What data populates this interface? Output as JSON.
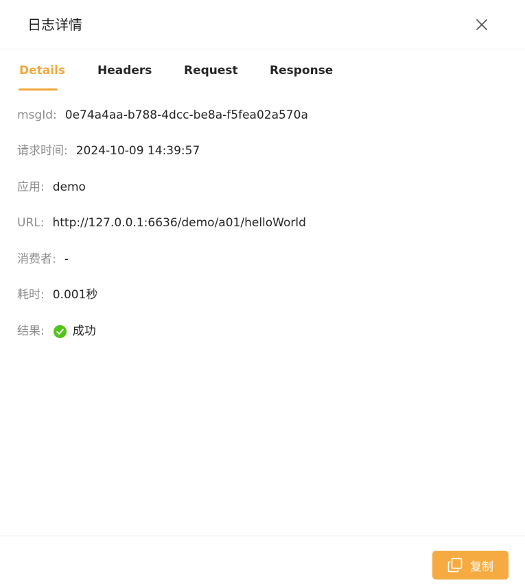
{
  "dialog": {
    "title": "日志详情",
    "close_icon": "close-icon"
  },
  "tabs": [
    {
      "label": "Details",
      "active": true
    },
    {
      "label": "Headers",
      "active": false
    },
    {
      "label": "Request",
      "active": false
    },
    {
      "label": "Response",
      "active": false
    }
  ],
  "details": {
    "msgid": {
      "label": "msgId:",
      "value": "0e74a4aa-b788-4dcc-be8a-f5fea02a570a"
    },
    "request_time": {
      "label": "请求时间:",
      "value": "2024-10-09 14:39:57"
    },
    "app": {
      "label": "应用:",
      "value": "demo"
    },
    "url": {
      "label": "URL:",
      "value": "http://127.0.0.1:6636/demo/a01/helloWorld"
    },
    "consumer": {
      "label": "消费者:",
      "value": "-"
    },
    "duration": {
      "label": "耗时:",
      "value": "0.001秒"
    },
    "result": {
      "label": "结果:",
      "value": "成功",
      "icon": "check-circle-icon",
      "color": "#52c41a"
    }
  },
  "footer": {
    "copy_label": "复制",
    "copy_icon": "copy-icon"
  },
  "colors": {
    "accent": "#f5ab41",
    "label": "#8c8c8c",
    "success": "#52c41a"
  }
}
